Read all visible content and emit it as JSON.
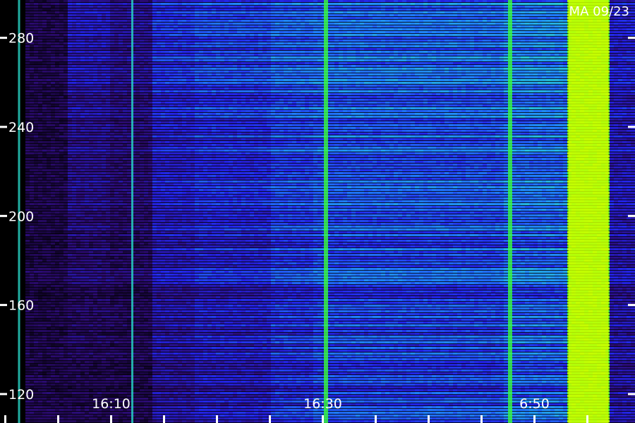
{
  "chart_data": {
    "type": "heatmap",
    "title": "",
    "corner_label": "MA 09/23",
    "xlabel": "",
    "ylabel": "",
    "x_tick_labels": [
      {
        "label": "16:10",
        "minutes": 10
      },
      {
        "label": "16:30",
        "minutes": 30
      },
      {
        "label": "6:50",
        "minutes": 50
      }
    ],
    "y_ticks": [
      120,
      160,
      200,
      240,
      280
    ],
    "ylim": [
      107,
      297
    ],
    "x_minutes_range": [
      -0.5,
      59.5
    ],
    "grid": false,
    "colormap": [
      "#000000",
      "#2a0a6e",
      "#2323e6",
      "#1f7fff",
      "#28d8c8",
      "#39ff3a",
      "#c8ff00"
    ],
    "vertical_bursts": [
      {
        "minutes": 1.3,
        "intensity": "medium"
      },
      {
        "minutes": 12.0,
        "intensity": "medium"
      },
      {
        "minutes": 30.2,
        "intensity": "high"
      },
      {
        "minutes": 47.6,
        "intensity": "high"
      },
      {
        "minutes": 53.5,
        "start": 53.2,
        "end": 57.0,
        "intensity": "very-high"
      }
    ]
  }
}
